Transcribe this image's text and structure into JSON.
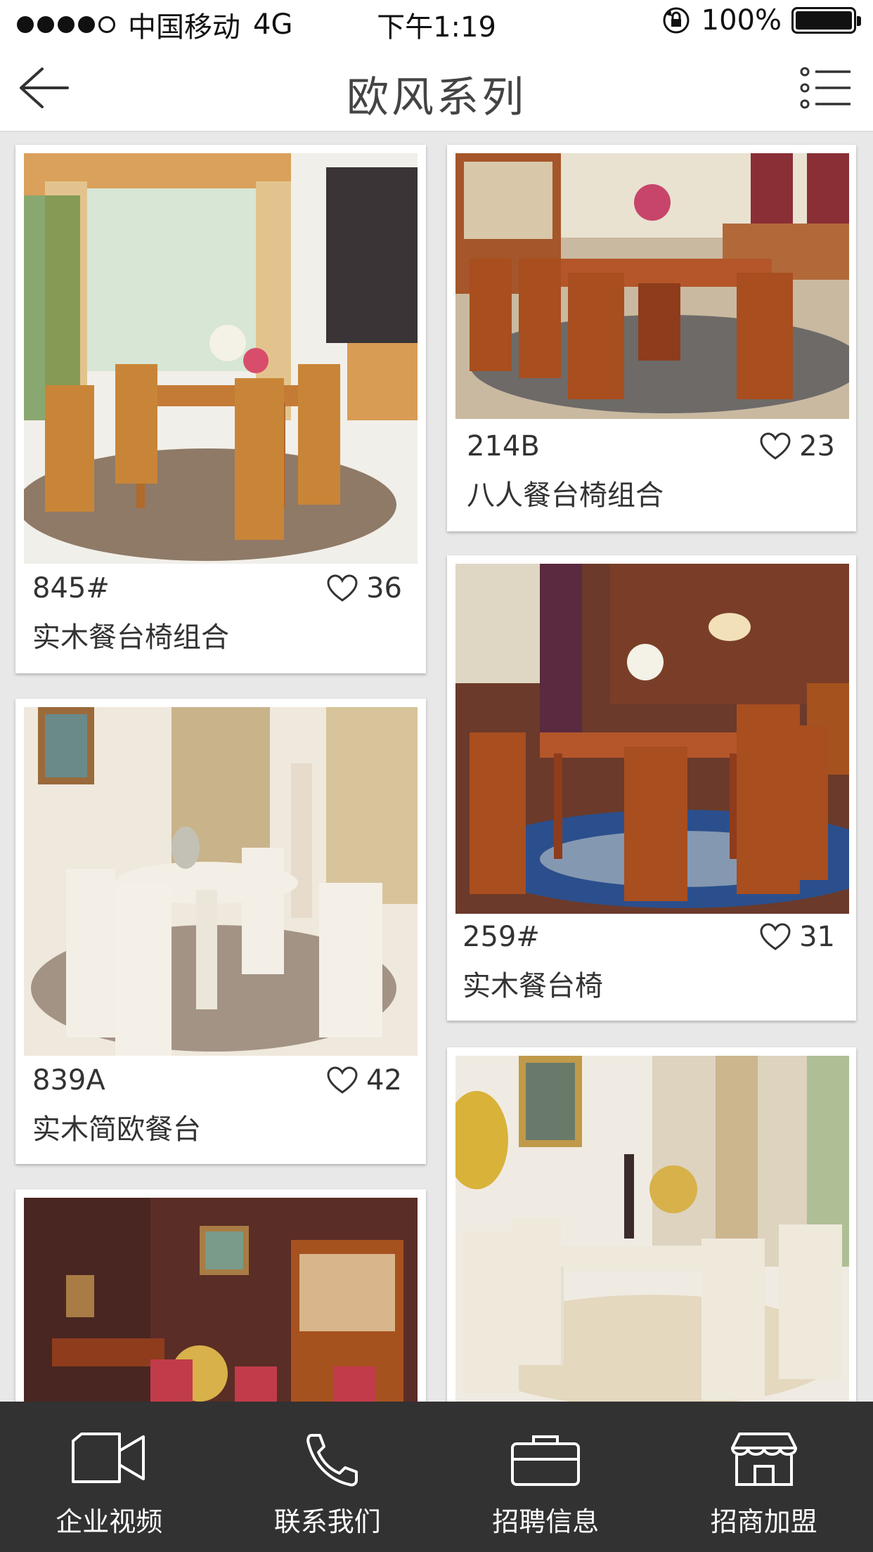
{
  "status_bar": {
    "carrier": "中国移动",
    "network": "4G",
    "time": "下午1:19",
    "battery": "100%"
  },
  "navbar": {
    "title": "欧风系列",
    "back_icon": "arrow-left-icon",
    "menu_icon": "list-icon"
  },
  "products": [
    {
      "code": "845#",
      "likes": "36",
      "name": "实木餐台椅组合"
    },
    {
      "code": "214B",
      "likes": "23",
      "name": "八人餐台椅组合"
    },
    {
      "code": "839A",
      "likes": "42",
      "name": "实木简欧餐台"
    },
    {
      "code": "259#",
      "likes": "31",
      "name": "实木餐台椅"
    }
  ],
  "tabs": [
    {
      "label": "企业视频",
      "icon": "video-camera-icon"
    },
    {
      "label": "联系我们",
      "icon": "phone-icon"
    },
    {
      "label": "招聘信息",
      "icon": "briefcase-icon"
    },
    {
      "label": "招商加盟",
      "icon": "store-icon"
    }
  ],
  "colors": {
    "background": "#e8e8e8",
    "tabbar": "#323232",
    "card": "#ffffff"
  }
}
